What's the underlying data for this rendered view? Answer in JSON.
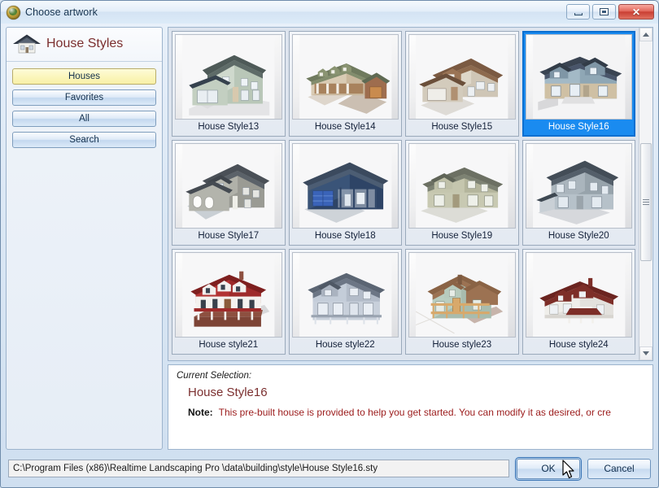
{
  "window": {
    "title": "Choose artwork",
    "icon": "globe-icon",
    "caption_buttons": {
      "minimize": "minimize-icon",
      "maximize": "restore-icon",
      "close": "✕"
    }
  },
  "sidebar": {
    "icon": "house-icon",
    "title": "House Styles",
    "buttons": [
      {
        "label": "Houses",
        "active": true
      },
      {
        "label": "Favorites",
        "active": false
      },
      {
        "label": "All",
        "active": false
      },
      {
        "label": "Search",
        "active": false
      }
    ]
  },
  "gallery": {
    "items": [
      {
        "label": "House Style13",
        "selected": false,
        "style": "two-story-green"
      },
      {
        "label": "House Style14",
        "selected": false,
        "style": "ranch-tan"
      },
      {
        "label": "House Style15",
        "selected": false,
        "style": "brown-roof-garage"
      },
      {
        "label": "House Style16",
        "selected": true,
        "style": "blue-two-story"
      },
      {
        "label": "House Style17",
        "selected": false,
        "style": "gray-colonial"
      },
      {
        "label": "House Style18",
        "selected": false,
        "style": "navy-ranch"
      },
      {
        "label": "House Style19",
        "selected": false,
        "style": "sage-cottage"
      },
      {
        "label": "House Style20",
        "selected": false,
        "style": "slate-two-story"
      },
      {
        "label": "House style21",
        "selected": false,
        "style": "red-roof-farmhouse"
      },
      {
        "label": "House style22",
        "selected": false,
        "style": "gray-victorian"
      },
      {
        "label": "House style23",
        "selected": false,
        "style": "green-craftsman"
      },
      {
        "label": "House style24",
        "selected": false,
        "style": "burgundy-ranch"
      }
    ],
    "scrollbar": {
      "up_arrow": "chevron-up-icon",
      "down_arrow": "chevron-down-icon"
    }
  },
  "description": {
    "heading": "Current Selection:",
    "name": "House Style16",
    "note_label": "Note:",
    "note_text": "This pre-built house is provided to help you get started. You can modify it as desired, or cre"
  },
  "footer": {
    "path": "C:\\Program Files (x86)\\Realtime Landscaping Pro \\data\\building\\style\\House Style16.sty",
    "ok_label": "OK",
    "cancel_label": "Cancel"
  },
  "colors": {
    "selection_blue": "#1a8bf0",
    "accent_maroon": "#7b2f2f",
    "note_red": "#9b1b1b",
    "active_button_yellow": "#fbf6bd"
  }
}
